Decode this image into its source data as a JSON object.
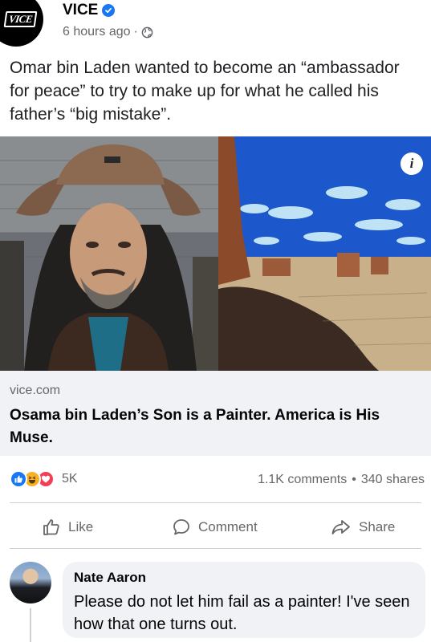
{
  "post": {
    "page_name": "VICE",
    "logo_text": "VICE",
    "timestamp": "6 hours ago",
    "separator": "·",
    "text": "Omar bin Laden wanted to become an “ambassador for peace” to try to make up for what he called his father’s “big mistake”."
  },
  "link": {
    "domain": "vice.com",
    "title": "Osama bin Laden’s Son is a Painter. America is His Muse."
  },
  "stats": {
    "reaction_count": "5K",
    "comments": "1.1K comments",
    "dot": "•",
    "shares": "340 shares"
  },
  "actions": {
    "like": "Like",
    "comment": "Comment",
    "share": "Share"
  },
  "comment": {
    "author": "Nate Aaron",
    "text": "Please do not let him fail as a painter! I've seen how that one turns out."
  },
  "colors": {
    "facebook_blue": "#1877f2",
    "secondary_text": "#65676b",
    "bubble_bg": "#f0f2f5"
  }
}
